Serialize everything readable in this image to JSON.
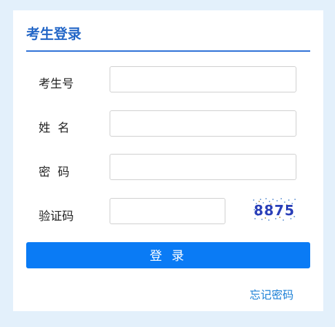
{
  "login_panel": {
    "title": "考生登录",
    "fields": {
      "exam_number": {
        "label": "考生号",
        "value": "",
        "placeholder": ""
      },
      "name": {
        "label": "姓  名",
        "value": "",
        "placeholder": ""
      },
      "password": {
        "label": "密  码",
        "value": "",
        "placeholder": ""
      },
      "captcha": {
        "label": "验证码",
        "value": "",
        "placeholder": "",
        "image_text": "8875"
      }
    },
    "login_button_label": "登 录",
    "forgot_password_link": "忘记密码",
    "colors": {
      "accent": "#0a7bf5",
      "title": "#2467c7",
      "link": "#1a7fd6",
      "page_background": "#e3f0fb"
    }
  }
}
